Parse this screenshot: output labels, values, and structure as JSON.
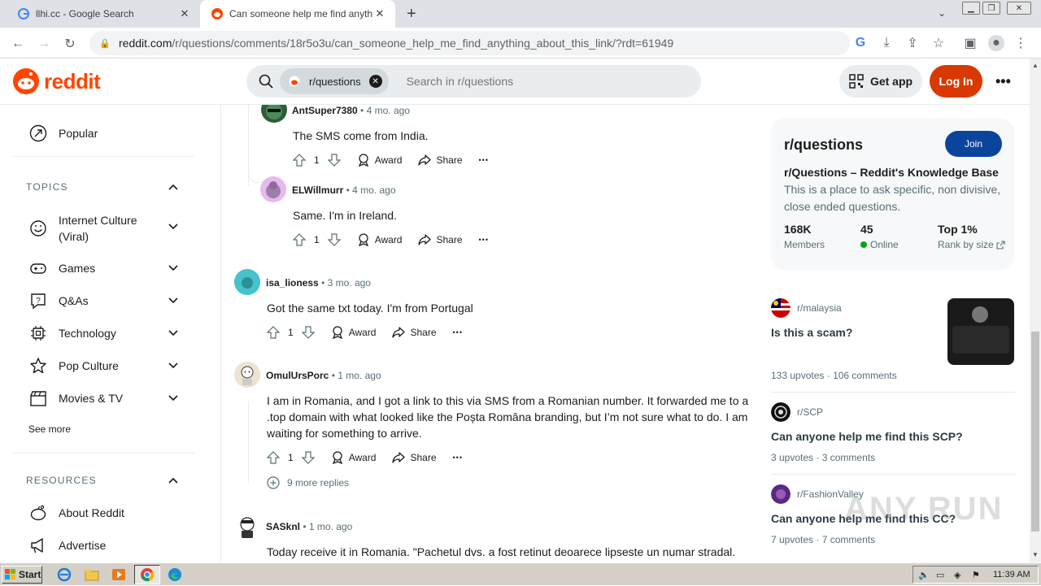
{
  "browser": {
    "tabs": [
      {
        "title": "llhi.cc - Google Search",
        "active": false
      },
      {
        "title": "Can someone help me find anything",
        "active": true
      }
    ],
    "new_tab": "+",
    "url_host": "reddit.com",
    "url_path": "/r/questions/comments/18r5o3u/can_someone_help_me_find_anything_about_this_link/?rdt=61949"
  },
  "header": {
    "brand": "reddit",
    "search_chip": "r/questions",
    "search_placeholder": "Search in r/questions",
    "get_app": "Get app",
    "login": "Log In"
  },
  "sidebar": {
    "popular": "Popular",
    "topics_label": "TOPICS",
    "topics": [
      {
        "label": "Internet Culture (Viral)",
        "icon": "smile-icon"
      },
      {
        "label": "Games",
        "icon": "gamepad-icon"
      },
      {
        "label": "Q&As",
        "icon": "question-icon"
      },
      {
        "label": "Technology",
        "icon": "chip-icon"
      },
      {
        "label": "Pop Culture",
        "icon": "star-icon"
      },
      {
        "label": "Movies & TV",
        "icon": "clapper-icon"
      }
    ],
    "see_more": "See more",
    "resources_label": "RESOURCES",
    "resources": [
      {
        "label": "About Reddit",
        "icon": "reddit-alien-icon"
      },
      {
        "label": "Advertise",
        "icon": "megaphone-icon"
      }
    ]
  },
  "comments": [
    {
      "author": "AntSuper7380",
      "time": "4 mo. ago",
      "body": "The SMS come from India.",
      "votes": "1"
    },
    {
      "author": "ELWillmurr",
      "time": "4 mo. ago",
      "body": "Same. I'm in Ireland.",
      "votes": "1"
    },
    {
      "author": "isa_lioness",
      "time": "3 mo. ago",
      "body": "Got the same txt today. I'm from Portugal",
      "votes": "1"
    },
    {
      "author": "OmulUrsPorc",
      "time": "1 mo. ago",
      "body": "I am in Romania, and I got a link to this via SMS from a Romanian number. It forwarded me to a .top domain with what looked like the Poșta Româna branding, but I’m not sure what to do. I am waiting for something to arrive.",
      "votes": "1",
      "more_replies": "9 more replies"
    },
    {
      "author": "SASknl",
      "time": "1 mo. ago",
      "body": "Today receive it in Romania. \"Pachetul dvs. a fost retinut deoarece lipseste un numar stradal."
    }
  ],
  "actions": {
    "award": "Award",
    "share": "Share",
    "more": "•••"
  },
  "rail": {
    "title": "r/questions",
    "join": "Join",
    "subtitle": "r/Questions – Reddit's Knowledge Base",
    "description": "This is a place to ask specific, non divisive, close ended questions.",
    "stats": [
      {
        "value": "168K",
        "label": "Members"
      },
      {
        "value": "45",
        "label": "Online"
      },
      {
        "value": "Top 1%",
        "label": "Rank by size"
      }
    ]
  },
  "related": [
    {
      "sub": "r/malaysia",
      "title": "Is this a scam?",
      "upvotes": "133 upvotes",
      "comments": "106 comments"
    },
    {
      "sub": "r/SCP",
      "title": "Can anyone help me find this SCP?",
      "upvotes": "3 upvotes",
      "comments": "3 comments"
    },
    {
      "sub": "r/FashionValley",
      "title": "Can anyone help me find this CC?",
      "upvotes": "7 upvotes",
      "comments": "7 comments"
    }
  ],
  "taskbar": {
    "start": "Start",
    "clock": "11:39 AM"
  },
  "watermark": "ANY RUN",
  "colors": {
    "reddit_orange": "#ff4500",
    "login_bg": "#d93900",
    "join_bg": "#0a449b",
    "online_dot": "#01a816"
  }
}
